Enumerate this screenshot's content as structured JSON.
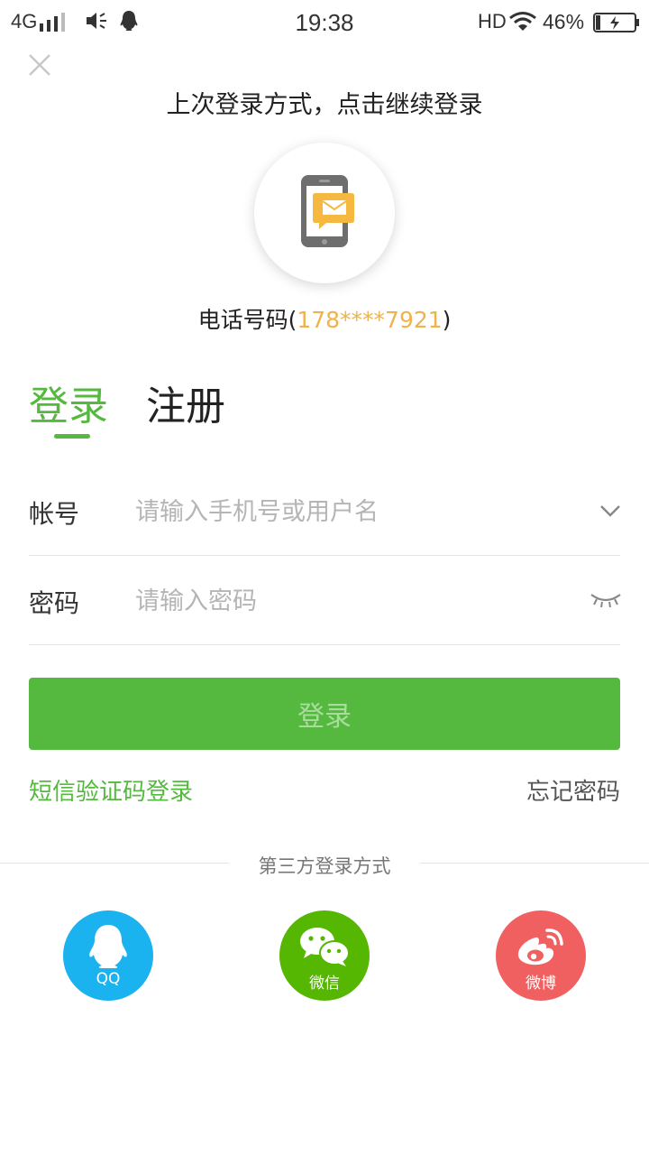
{
  "status_bar": {
    "network": "4G",
    "time": "19:38",
    "hd": "HD",
    "battery_percent": "46%"
  },
  "header": {
    "last_login_text": "上次登录方式，点击继续登录",
    "phone_prefix": "电话号码(",
    "phone_number": "178****7921",
    "phone_suffix": ")"
  },
  "tabs": {
    "login": "登录",
    "register": "注册"
  },
  "form": {
    "account_label": "帐号",
    "account_placeholder": "请输入手机号或用户名",
    "password_label": "密码",
    "password_placeholder": "请输入密码",
    "submit_label": "登录"
  },
  "links": {
    "sms_login": "短信验证码登录",
    "forgot_password": "忘记密码"
  },
  "third_party": {
    "title": "第三方登录方式",
    "providers": [
      {
        "label": "QQ",
        "icon": "qq-penguin-icon",
        "color": "#1ab2ef"
      },
      {
        "label": "微信",
        "icon": "wechat-icon",
        "color": "#55b702"
      },
      {
        "label": "微博",
        "icon": "weibo-icon",
        "color": "#f06060"
      }
    ]
  },
  "colors": {
    "accent": "#55b93f",
    "phone_number": "#f0b24a"
  }
}
